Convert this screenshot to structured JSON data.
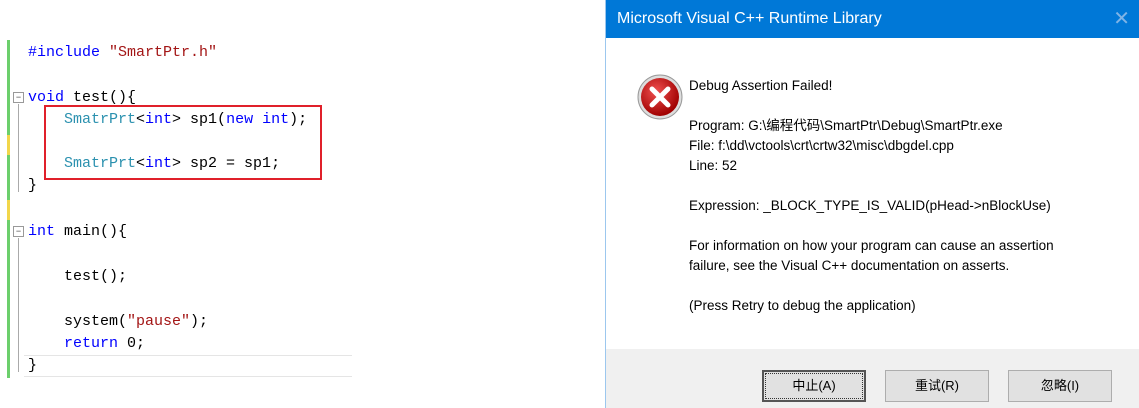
{
  "editor": {
    "lines": {
      "include_kw": "#include",
      "include_str": "\"SmartPtr.h\"",
      "void_kw": "void",
      "test_sig": " test(){",
      "l1_type": "SmatrPrt",
      "l1_lt": "<",
      "int": "int",
      "l1_rest": "> sp1(",
      "new": "new",
      "l1_end": ");",
      "l2_rest": "> sp2 = sp1;",
      "brace_close": "}",
      "main_sig": " main(){",
      "test_call": "test();",
      "system_a": "system(",
      "pause_str": "\"pause\"",
      "system_b": ");",
      "return_kw": "return",
      "return_rest": " 0;"
    }
  },
  "dialog": {
    "title": "Microsoft Visual C++ Runtime Library",
    "close": "✕",
    "icon": "error-icon",
    "message": [
      "Debug Assertion Failed!",
      "",
      "Program: G:\\编程代码\\SmartPtr\\Debug\\SmartPtr.exe",
      "File: f:\\dd\\vctools\\crt\\crtw32\\misc\\dbgdel.cpp",
      "Line: 52",
      "",
      "Expression: _BLOCK_TYPE_IS_VALID(pHead->nBlockUse)",
      "",
      "For information on how your program can cause an assertion",
      "failure, see the Visual C++ documentation on asserts.",
      "",
      "(Press Retry to debug the application)"
    ],
    "buttons": {
      "abort": "中止(A)",
      "retry": "重试(R)",
      "ignore": "忽略(I)"
    },
    "colors": {
      "titlebar": "#0078d7",
      "button_area": "#f0f0f0"
    }
  }
}
